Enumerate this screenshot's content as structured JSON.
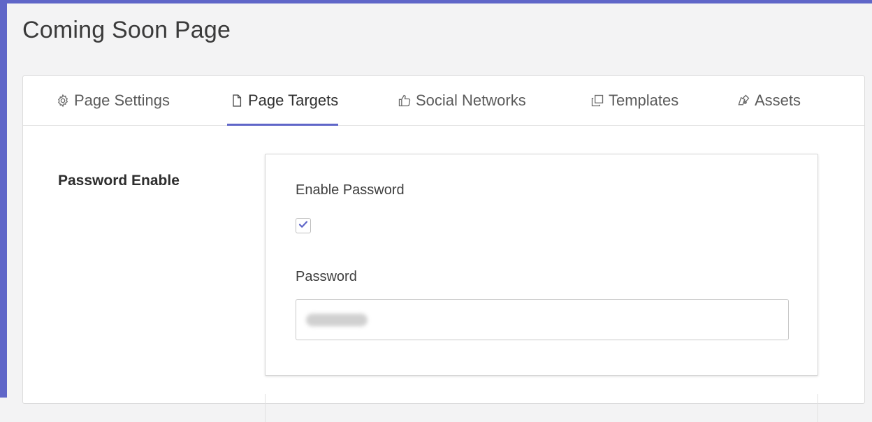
{
  "page": {
    "title": "Coming Soon Page"
  },
  "tabs": [
    {
      "label": "Page Settings",
      "icon": "gear-icon",
      "active": false
    },
    {
      "label": "Page Targets",
      "icon": "page-icon",
      "active": true
    },
    {
      "label": "Social Networks",
      "icon": "thumbs-up-icon",
      "active": false
    },
    {
      "label": "Templates",
      "icon": "copy-icon",
      "active": false
    },
    {
      "label": "Assets",
      "icon": "assets-icon",
      "active": false
    }
  ],
  "password_section": {
    "label": "Password Enable",
    "enable_label": "Enable Password",
    "enabled": true,
    "password_label": "Password",
    "password_value": ""
  },
  "colors": {
    "accent": "#5f66c8",
    "frame": "#5f66c8",
    "background": "#f3f3f4"
  }
}
